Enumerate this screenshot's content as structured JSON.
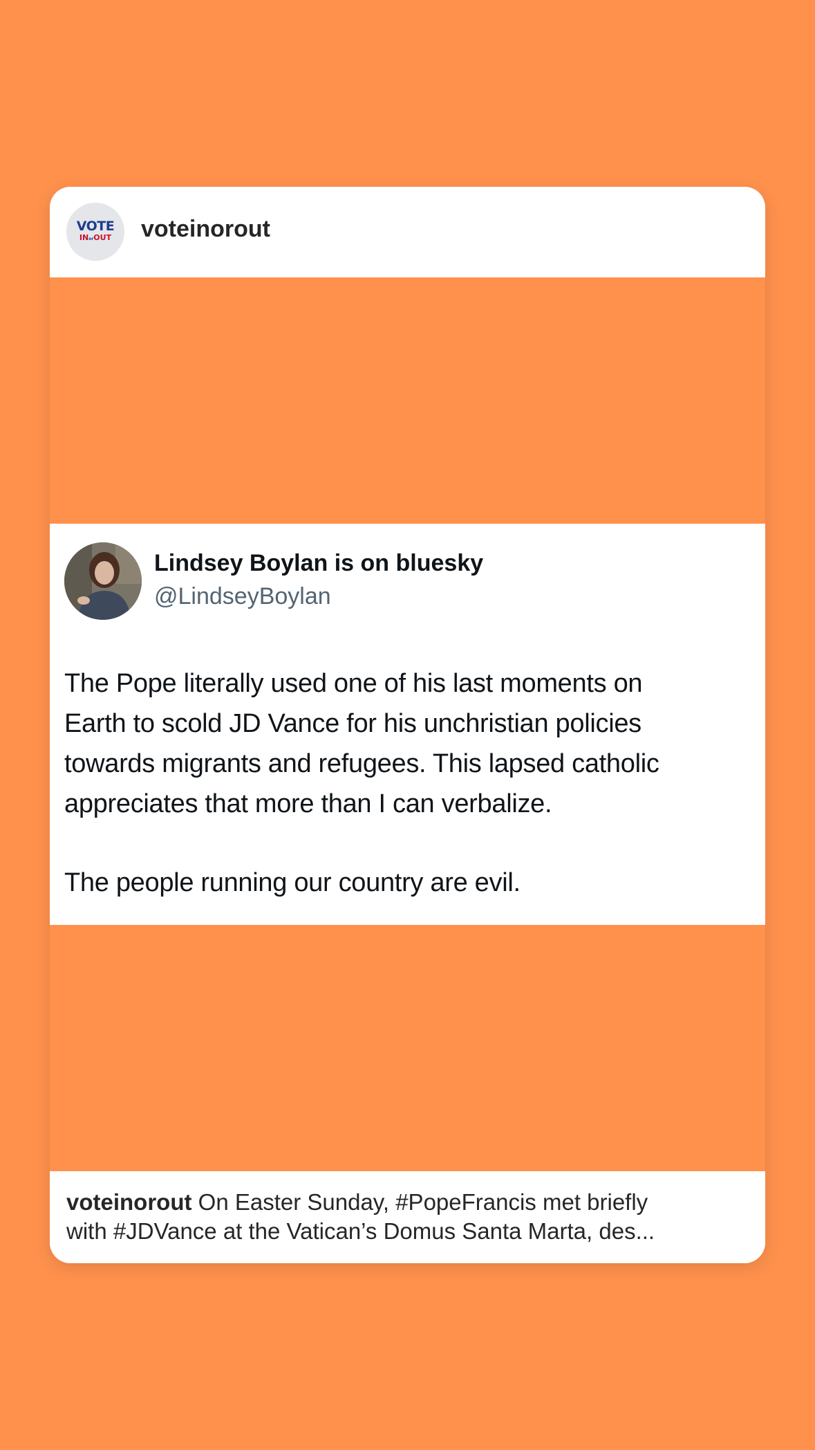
{
  "post": {
    "username": "voteinorout",
    "avatar_logo": {
      "top": "VOTE",
      "bottom_left": "IN",
      "bottom_mid": "or",
      "bottom_right": "OUT"
    },
    "media_background": "#FF914D",
    "tweet": {
      "display_name": "Lindsey Boylan is on bluesky",
      "handle": "@LindseyBoylan",
      "lines": [
        "The Pope literally used one of his last moments on",
        "Earth to scold JD Vance for his unchristian policies",
        "towards migrants and refugees. This lapsed catholic",
        "appreciates that more than I can verbalize."
      ],
      "closing_line": "The people running our country are evil."
    },
    "caption": {
      "username": "voteinorout",
      "line1": "On Easter Sunday, #PopeFrancis met briefly",
      "line2": "with #JDVance at the Vatican’s Domus Santa Marta, des..."
    }
  },
  "colors": {
    "page_background": "#FF914D",
    "card": "#FFFFFF",
    "text_primary": "#262626",
    "tweet_text": "#0F1419",
    "tweet_handle": "#536471",
    "logo_blue": "#1E3D8F",
    "logo_red": "#C8102E"
  }
}
